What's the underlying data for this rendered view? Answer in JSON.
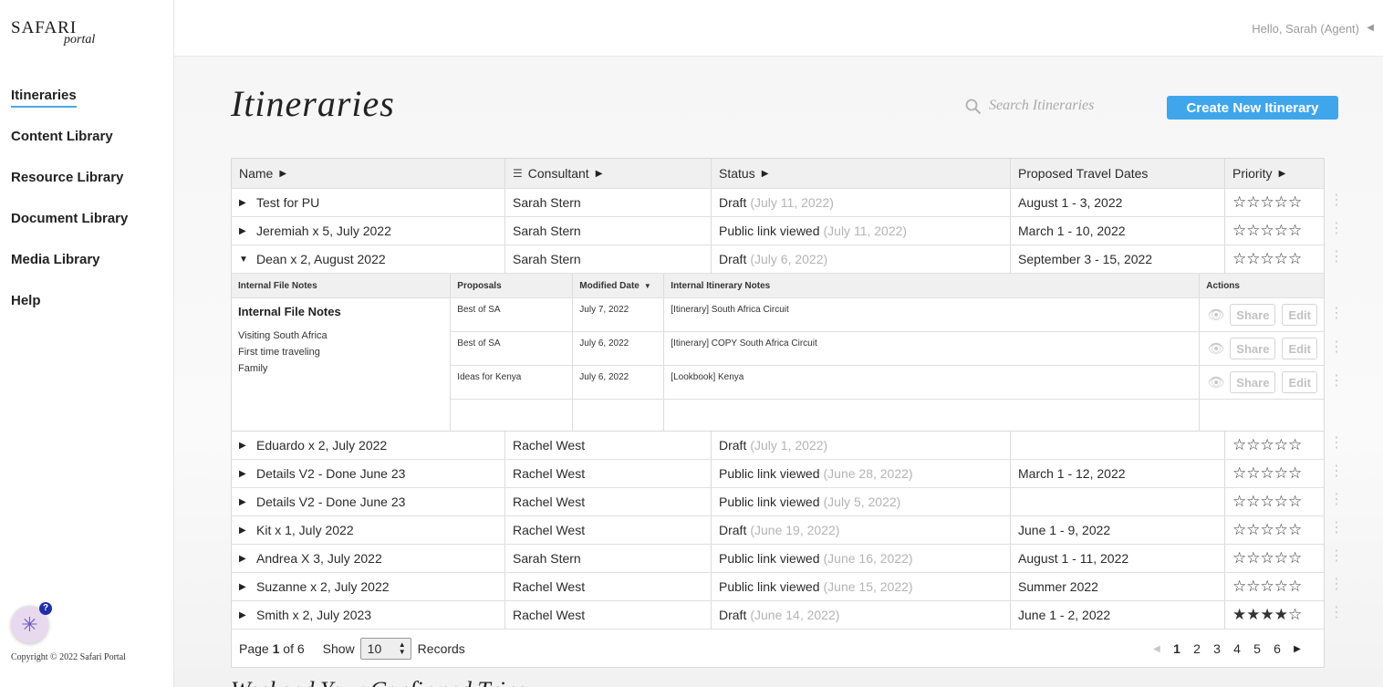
{
  "app": {
    "logo_main": "SAFARI",
    "logo_sub": "portal",
    "greeting": "Hello, Sarah (Agent)",
    "copyright": "Copyright © 2022 Safari Portal"
  },
  "nav": [
    {
      "label": "Itineraries",
      "active": true
    },
    {
      "label": "Content Library"
    },
    {
      "label": "Resource Library"
    },
    {
      "label": "Document Library"
    },
    {
      "label": "Media Library"
    },
    {
      "label": "Help"
    }
  ],
  "page": {
    "title": "Itineraries",
    "search_placeholder": "Search Itineraries",
    "create_label": "Create New Itinerary",
    "next_section_title": "Weekend Your Confirmed Trips"
  },
  "table": {
    "headers": {
      "name": "Name",
      "consultant": "Consultant",
      "status": "Status",
      "dates": "Proposed Travel Dates",
      "priority": "Priority"
    },
    "rows": [
      {
        "name": "Test for PU",
        "consultant": "Sarah Stern",
        "status": "Draft",
        "status_date": "(July 11, 2022)",
        "dates": "August 1 - 3, 2022",
        "stars": "☆☆☆☆☆"
      },
      {
        "name": "Jeremiah x 5, July 2022",
        "consultant": "Sarah Stern",
        "status": "Public link viewed",
        "status_date": "(July 11, 2022)",
        "dates": "March 1 - 10, 2022",
        "stars": "☆☆☆☆☆"
      },
      {
        "name": "Dean x 2, August 2022",
        "consultant": "Sarah Stern",
        "status": "Draft",
        "status_date": "(July 6, 2022)",
        "dates": "September 3 - 15, 2022",
        "stars": "☆☆☆☆☆",
        "expanded": true
      },
      {
        "name": "Eduardo x 2, July 2022",
        "consultant": "Rachel West",
        "status": "Draft",
        "status_date": "(July 1, 2022)",
        "dates": "",
        "stars": "☆☆☆☆☆"
      },
      {
        "name": "Details V2 - Done June 23",
        "consultant": "Rachel West",
        "status": "Public link viewed",
        "status_date": "(June 28, 2022)",
        "dates": "March 1 - 12, 2022",
        "stars": "☆☆☆☆☆"
      },
      {
        "name": "Details V2 - Done June 23",
        "consultant": "Rachel West",
        "status": "Public link viewed",
        "status_date": "(July 5, 2022)",
        "dates": "",
        "stars": "☆☆☆☆☆"
      },
      {
        "name": "Kit x 1, July 2022",
        "consultant": "Rachel West",
        "status": "Draft",
        "status_date": "(June 19, 2022)",
        "dates": "June 1 - 9, 2022",
        "stars": "☆☆☆☆☆"
      },
      {
        "name": "Andrea X 3, July 2022",
        "consultant": "Sarah Stern",
        "status": "Public link viewed",
        "status_date": "(June 16, 2022)",
        "dates": "August 1 - 11, 2022",
        "stars": "☆☆☆☆☆"
      },
      {
        "name": "Suzanne x 2, July 2022",
        "consultant": "Rachel West",
        "status": "Public link viewed",
        "status_date": "(June 15, 2022)",
        "dates": "Summer 2022",
        "stars": "☆☆☆☆☆"
      },
      {
        "name": "Smith x 2, July 2023",
        "consultant": "Rachel West",
        "status": "Draft",
        "status_date": "(June 14, 2022)",
        "dates": "June 1 - 2, 2022",
        "stars": "★★★★☆"
      }
    ]
  },
  "detail": {
    "headers": {
      "notes": "Internal File Notes",
      "proposals": "Proposals",
      "modified": "Modified Date",
      "itinerary_notes": "Internal Itinerary Notes",
      "actions": "Actions"
    },
    "notes_title": "Internal File Notes",
    "notes_lines": [
      "Visiting South Africa",
      "First time traveling",
      "Family"
    ],
    "share_label": "Share",
    "edit_label": "Edit",
    "proposals": [
      {
        "name": "Best of SA",
        "modified": "July 7, 2022",
        "note": "[Itinerary] South Africa Circuit"
      },
      {
        "name": "Best of SA",
        "modified": "July 6, 2022",
        "note": "[Itinerary] COPY South Africa Circuit"
      },
      {
        "name": "Ideas for Kenya",
        "modified": "July 6, 2022",
        "note": "[Lookbook] Kenya"
      }
    ]
  },
  "footer": {
    "page_label": "Page",
    "page_current": "1",
    "page_of": "of 6",
    "show_label": "Show",
    "show_value": "10",
    "records_label": "Records",
    "pages": [
      "1",
      "2",
      "3",
      "4",
      "5",
      "6"
    ]
  }
}
